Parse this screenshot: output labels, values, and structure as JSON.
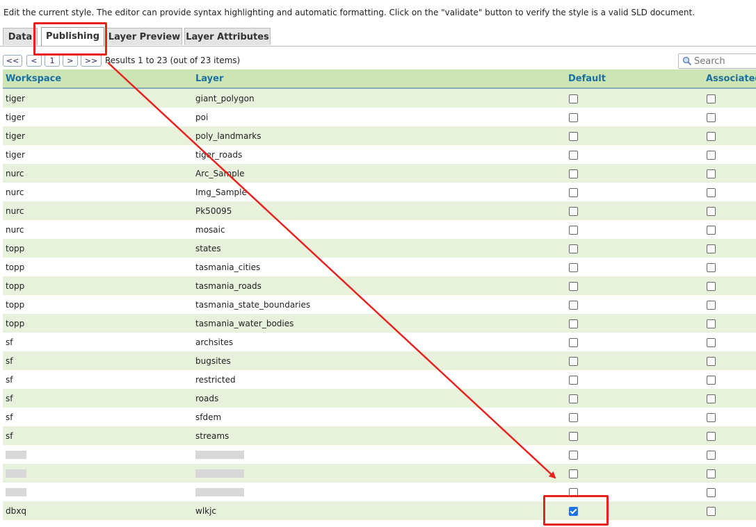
{
  "intro": "Edit the current style. The editor can provide syntax highlighting and automatic formatting. Click on the \"validate\" button to verify the style is a valid SLD document.",
  "tabs": [
    {
      "label": "Data",
      "active": false
    },
    {
      "label": "Publishing",
      "active": true
    },
    {
      "label": "Layer Preview",
      "active": false
    },
    {
      "label": "Layer Attributes",
      "active": false
    }
  ],
  "pager": {
    "first": "<<",
    "prev": "<",
    "page": "1",
    "next": ">",
    "last": ">>",
    "info": "Results 1 to 23 (out of 23 items)"
  },
  "search": {
    "placeholder": "Search"
  },
  "columns": {
    "workspace": "Workspace",
    "layer": "Layer",
    "default": "Default",
    "associated": "Associated"
  },
  "rows": [
    {
      "workspace": "tiger",
      "layer": "giant_polygon",
      "default": false,
      "associated": false
    },
    {
      "workspace": "tiger",
      "layer": "poi",
      "default": false,
      "associated": false
    },
    {
      "workspace": "tiger",
      "layer": "poly_landmarks",
      "default": false,
      "associated": false
    },
    {
      "workspace": "tiger",
      "layer": "tiger_roads",
      "default": false,
      "associated": false
    },
    {
      "workspace": "nurc",
      "layer": "Arc_Sample",
      "default": false,
      "associated": false
    },
    {
      "workspace": "nurc",
      "layer": "Img_Sample",
      "default": false,
      "associated": false
    },
    {
      "workspace": "nurc",
      "layer": "Pk50095",
      "default": false,
      "associated": false
    },
    {
      "workspace": "nurc",
      "layer": "mosaic",
      "default": false,
      "associated": false
    },
    {
      "workspace": "topp",
      "layer": "states",
      "default": false,
      "associated": false
    },
    {
      "workspace": "topp",
      "layer": "tasmania_cities",
      "default": false,
      "associated": false
    },
    {
      "workspace": "topp",
      "layer": "tasmania_roads",
      "default": false,
      "associated": false
    },
    {
      "workspace": "topp",
      "layer": "tasmania_state_boundaries",
      "default": false,
      "associated": false
    },
    {
      "workspace": "topp",
      "layer": "tasmania_water_bodies",
      "default": false,
      "associated": false
    },
    {
      "workspace": "sf",
      "layer": "archsites",
      "default": false,
      "associated": false
    },
    {
      "workspace": "sf",
      "layer": "bugsites",
      "default": false,
      "associated": false
    },
    {
      "workspace": "sf",
      "layer": "restricted",
      "default": false,
      "associated": false
    },
    {
      "workspace": "sf",
      "layer": "roads",
      "default": false,
      "associated": false
    },
    {
      "workspace": "sf",
      "layer": "sfdem",
      "default": false,
      "associated": false
    },
    {
      "workspace": "sf",
      "layer": "streams",
      "default": false,
      "associated": false
    },
    {
      "workspace": "",
      "layer": "",
      "default": false,
      "associated": false,
      "redacted": true
    },
    {
      "workspace": "",
      "layer": "",
      "default": false,
      "associated": false,
      "redacted": true
    },
    {
      "workspace": "",
      "layer": "",
      "default": false,
      "associated": false,
      "redacted": true
    },
    {
      "workspace": "dbxq",
      "layer": "wlkjc",
      "default": true,
      "associated": false
    }
  ],
  "colors": {
    "highlight": "#e8211f",
    "header_bg": "#cde5b5",
    "header_text": "#1a6fa0",
    "row_alt": "#e7f1dc"
  }
}
